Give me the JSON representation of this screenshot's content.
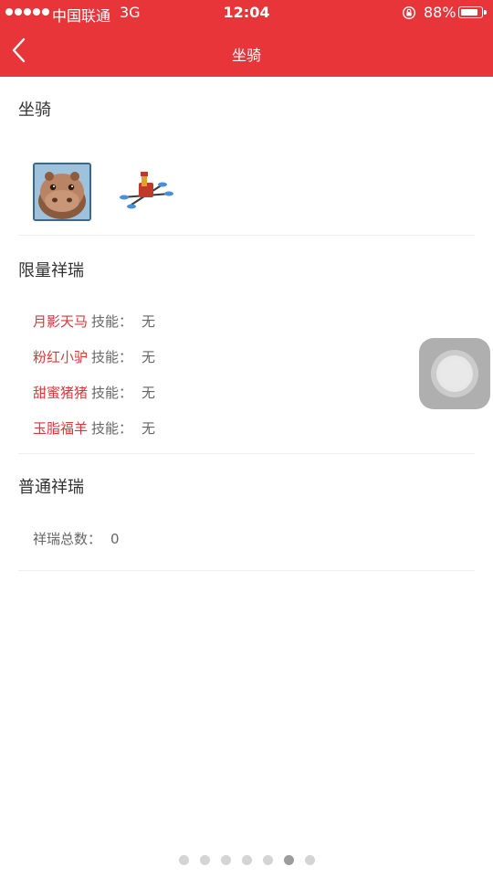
{
  "status_bar": {
    "carrier": "中国联通",
    "network": "3G",
    "time": "12:04",
    "battery_percent": "88%",
    "battery_level": 0.88
  },
  "header": {
    "title": "坐骑",
    "back_icon": "chevron-left-icon",
    "background_color": "#e8353a"
  },
  "mounts_section": {
    "title": "坐骑",
    "items": [
      {
        "name": "hippo-mount",
        "selected": true
      },
      {
        "name": "drone-mount",
        "selected": false
      }
    ]
  },
  "limited_section": {
    "title": "限量祥瑞",
    "skill_label": "技能：",
    "items": [
      {
        "name": "月影天马",
        "skill": "无"
      },
      {
        "name": "粉红小驴",
        "skill": "无"
      },
      {
        "name": "甜蜜猪猪",
        "skill": "无"
      },
      {
        "name": "玉脂福羊",
        "skill": "无"
      }
    ]
  },
  "normal_section": {
    "title": "普通祥瑞",
    "count_label": "祥瑞总数：",
    "count_value": "0"
  },
  "pagination": {
    "total": 7,
    "active_index": 5
  }
}
